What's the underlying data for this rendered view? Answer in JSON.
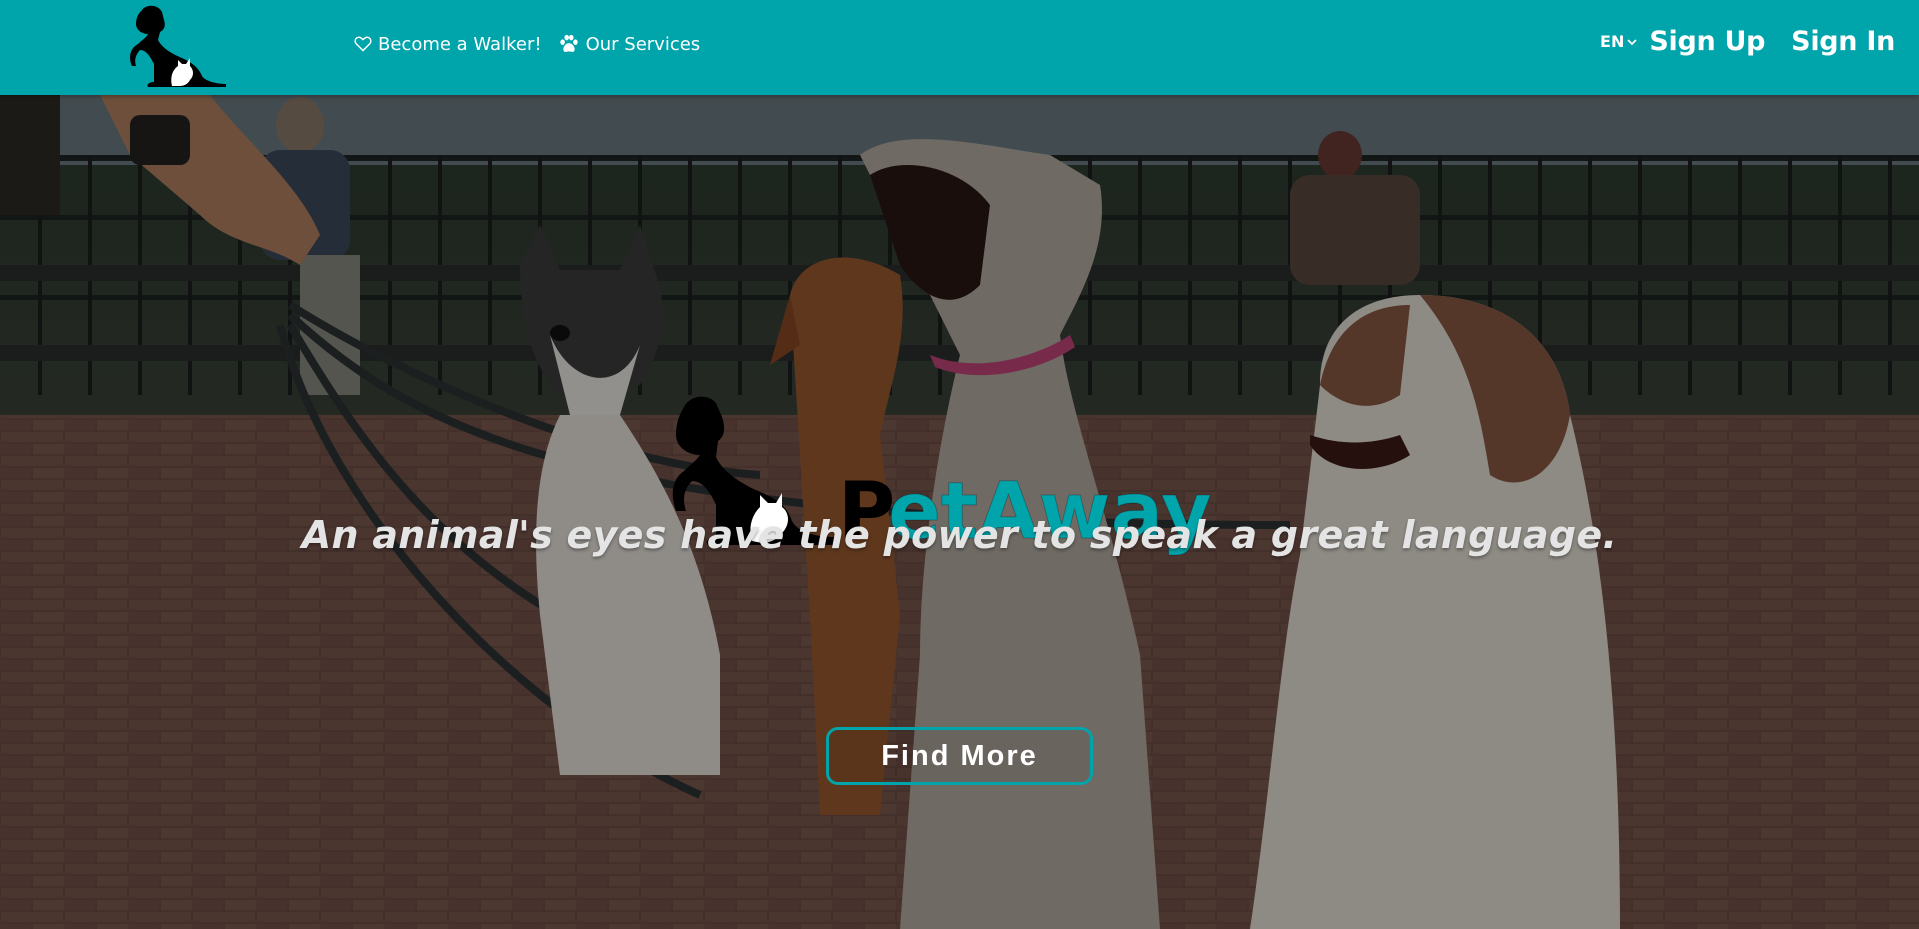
{
  "header": {
    "logo_icon": "dog-cat-silhouette-icon",
    "nav": [
      {
        "label": "Become a Walker!",
        "icon": "heart-outline-icon"
      },
      {
        "label": "Our Services",
        "icon": "paw-icon"
      }
    ],
    "language": {
      "label": "EN",
      "icon": "chevron-down-icon"
    },
    "sign_up": "Sign Up",
    "sign_in": "Sign In"
  },
  "hero": {
    "brand_first_letter": "P",
    "brand_rest": "etAway",
    "tagline": "An animal's eyes have the power to speak a great language.",
    "cta": "Find More"
  },
  "colors": {
    "primary": "#00a4ab",
    "brand_text": "#00a4ab",
    "white": "#ffffff"
  }
}
